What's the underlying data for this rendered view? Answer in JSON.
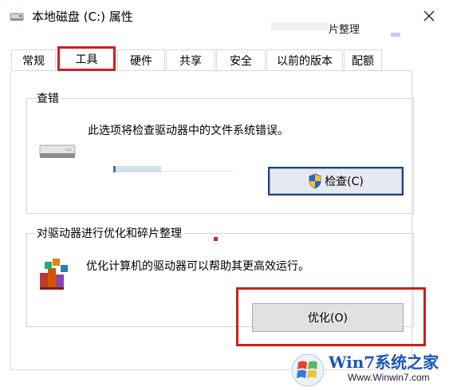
{
  "window": {
    "title": "本地磁盘 (C:) 属性",
    "close_icon": "close-icon",
    "background_fragment": "片整理"
  },
  "tabs": [
    {
      "label": "常规"
    },
    {
      "label": "工具",
      "selected": true
    },
    {
      "label": "硬件"
    },
    {
      "label": "共享"
    },
    {
      "label": "安全"
    },
    {
      "label": "以前的版本"
    },
    {
      "label": "配额"
    }
  ],
  "error_check": {
    "group_title": "查错",
    "description": "此选项将检查驱动器中的文件系统错误。",
    "button_label": "检查(C)",
    "icon": "drive-icon",
    "button_icon": "uac-shield-icon"
  },
  "optimize": {
    "group_title": "对驱动器进行优化和碎片整理",
    "description": "优化计算机的驱动器可以帮助其更高效运行。",
    "button_label": "优化(O)",
    "icon": "defrag-icon"
  },
  "watermark": {
    "brand": "Win7系统之家",
    "url": "Www.Winwin7.com"
  },
  "colors": {
    "highlight_red": "#cc1f1f",
    "focus_blue": "#1e3f7a",
    "watermark_blue": "#1b56b8"
  }
}
